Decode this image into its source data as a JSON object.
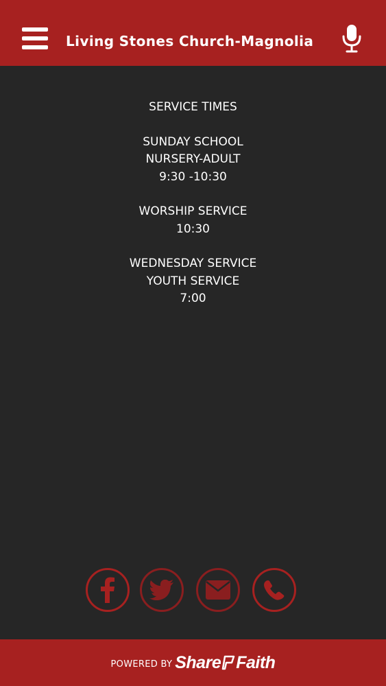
{
  "header": {
    "title": "Living Stones Church-Magnolia",
    "menu_icon": "hamburger-menu-icon",
    "mic_icon": "microphone-icon"
  },
  "content": {
    "sections": [
      {
        "lines": [
          "SERVICE TIMES"
        ]
      },
      {
        "lines": [
          "SUNDAY SCHOOL",
          "NURSERY-ADULT",
          "9:30 -10:30"
        ]
      },
      {
        "lines": [
          "WORSHIP SERVICE",
          "10:30"
        ]
      },
      {
        "lines": [
          "WEDNESDAY SERVICE",
          "YOUTH SERVICE",
          "7:00"
        ]
      }
    ]
  },
  "social": {
    "icons": [
      "facebook-icon",
      "twitter-icon",
      "email-icon",
      "phone-icon"
    ]
  },
  "footer": {
    "powered_by": "POWERED BY",
    "brand_part1": "Share",
    "brand_part2": "Faith"
  },
  "colors": {
    "primary": "#a72120",
    "background": "#262626",
    "text": "#ffffff"
  }
}
